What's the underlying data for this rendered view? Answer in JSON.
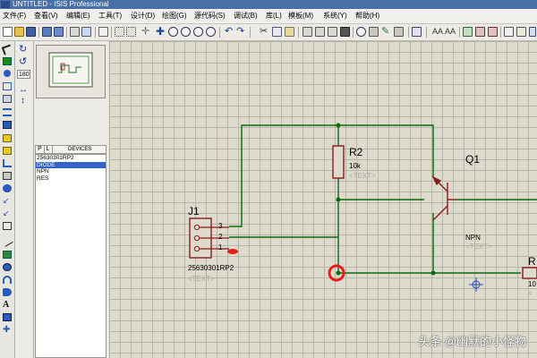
{
  "window": {
    "title": "UNTITLED - ISIS Professional"
  },
  "menu": [
    "文件(F)",
    "查看(V)",
    "编辑(E)",
    "工具(T)",
    "设计(D)",
    "绘图(G)",
    "源代码(S)",
    "调试(B)",
    "库(L)",
    "模板(M)",
    "系统(Y)",
    "帮助(H)"
  ],
  "rotation_value": "180",
  "devices_panel": {
    "p_button": "P",
    "l_button": "L",
    "header": "DEVICES",
    "items": [
      "25630301RP2",
      "DIODE",
      "NPN",
      "RES"
    ],
    "selected_index": 1
  },
  "schematic": {
    "j1": {
      "ref": "J1",
      "pins": [
        "3",
        "2",
        "1"
      ],
      "value": "25630301RP2",
      "text": "<TEXT>"
    },
    "r2": {
      "ref": "R2",
      "value": "10k",
      "text": "<TEXT>"
    },
    "q1": {
      "ref": "Q1",
      "value": "NPN",
      "text": "<TEXT>"
    },
    "r_partial": {
      "ref": "R",
      "value": "10",
      "text": "<"
    }
  },
  "watermark": "头条 @幽默的小怪物",
  "colors": {
    "wire": "#0b6b0b",
    "component": "#8b1a1a",
    "label_text": "#000000",
    "placeholder_text": "#a8a8a0",
    "highlight_marker": "#e61e1e",
    "grid_background": "#dcdbce",
    "selected_item": "#3264c8"
  }
}
